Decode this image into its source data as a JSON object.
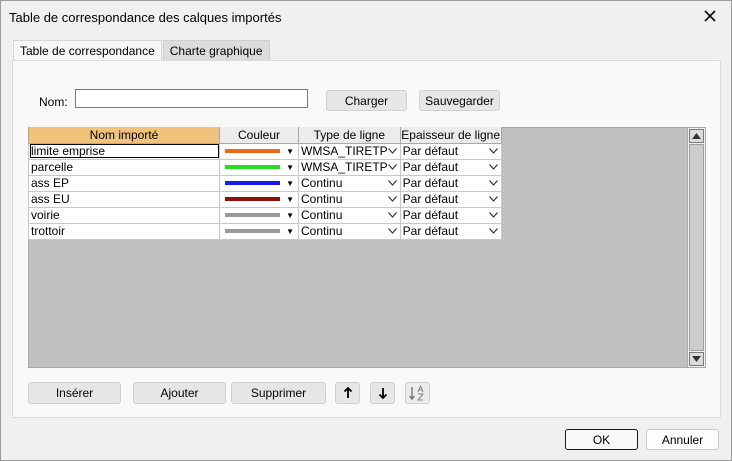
{
  "window": {
    "title": "Table de correspondance des calques importés"
  },
  "tabs": [
    {
      "label": "Table de correspondance"
    },
    {
      "label": "Charte graphique"
    }
  ],
  "form": {
    "name_label": "Nom:",
    "name_value": "",
    "load_label": "Charger",
    "save_label": "Sauvegarder"
  },
  "grid": {
    "columns": [
      "Nom importé",
      "Couleur",
      "Type de ligne",
      "Epaisseur de ligne"
    ],
    "rows": [
      {
        "name": "limite emprise",
        "color": "#ee6a1a",
        "line_type": "WMSA_TIRETP",
        "thickness": "Par défaut"
      },
      {
        "name": "parcelle",
        "color": "#22dd22",
        "line_type": "WMSA_TIRETP",
        "thickness": "Par défaut"
      },
      {
        "name": "ass EP",
        "color": "#1a1aee",
        "line_type": "Continu",
        "thickness": "Par défaut"
      },
      {
        "name": "ass EU",
        "color": "#8b1010",
        "line_type": "Continu",
        "thickness": "Par défaut"
      },
      {
        "name": "voirie",
        "color": "#9a9a9a",
        "line_type": "Continu",
        "thickness": "Par défaut"
      },
      {
        "name": "trottoir",
        "color": "#9a9a9a",
        "line_type": "Continu",
        "thickness": "Par défaut"
      }
    ]
  },
  "actions": {
    "insert_label": "Insérer",
    "add_label": "Ajouter",
    "delete_label": "Supprimer"
  },
  "footer": {
    "ok_label": "OK",
    "cancel_label": "Annuler"
  }
}
